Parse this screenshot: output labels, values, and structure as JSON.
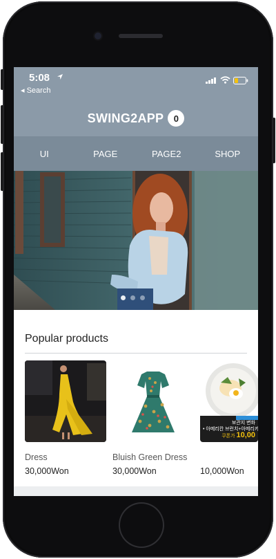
{
  "status_bar": {
    "time": "5:08",
    "back_label": "◂ Search"
  },
  "header": {
    "title": "SWING2APP",
    "cart_count": "0"
  },
  "nav": {
    "items": [
      {
        "label": "UI"
      },
      {
        "label": "PAGE"
      },
      {
        "label": "PAGE2"
      },
      {
        "label": "SHOP"
      }
    ]
  },
  "hero": {
    "slide_count": 3,
    "active_slide": 1
  },
  "products": {
    "section_title": "Popular products",
    "items": [
      {
        "name": "Dress",
        "price": "30,000Won"
      },
      {
        "name": "Bluish Green Dress",
        "price": "30,000Won"
      },
      {
        "name": "",
        "price": "10,000Won",
        "banner_line1": "보관지 변화",
        "banner_line2": "• 아메리칸 브런치+아메리카",
        "banner_price_label": "쿠폰가",
        "banner_price": "10,00"
      }
    ]
  },
  "colors": {
    "header_bg": "#8b9aa8",
    "nav_bg": "#7b8b99",
    "accent_yellow": "#f4c20d"
  }
}
